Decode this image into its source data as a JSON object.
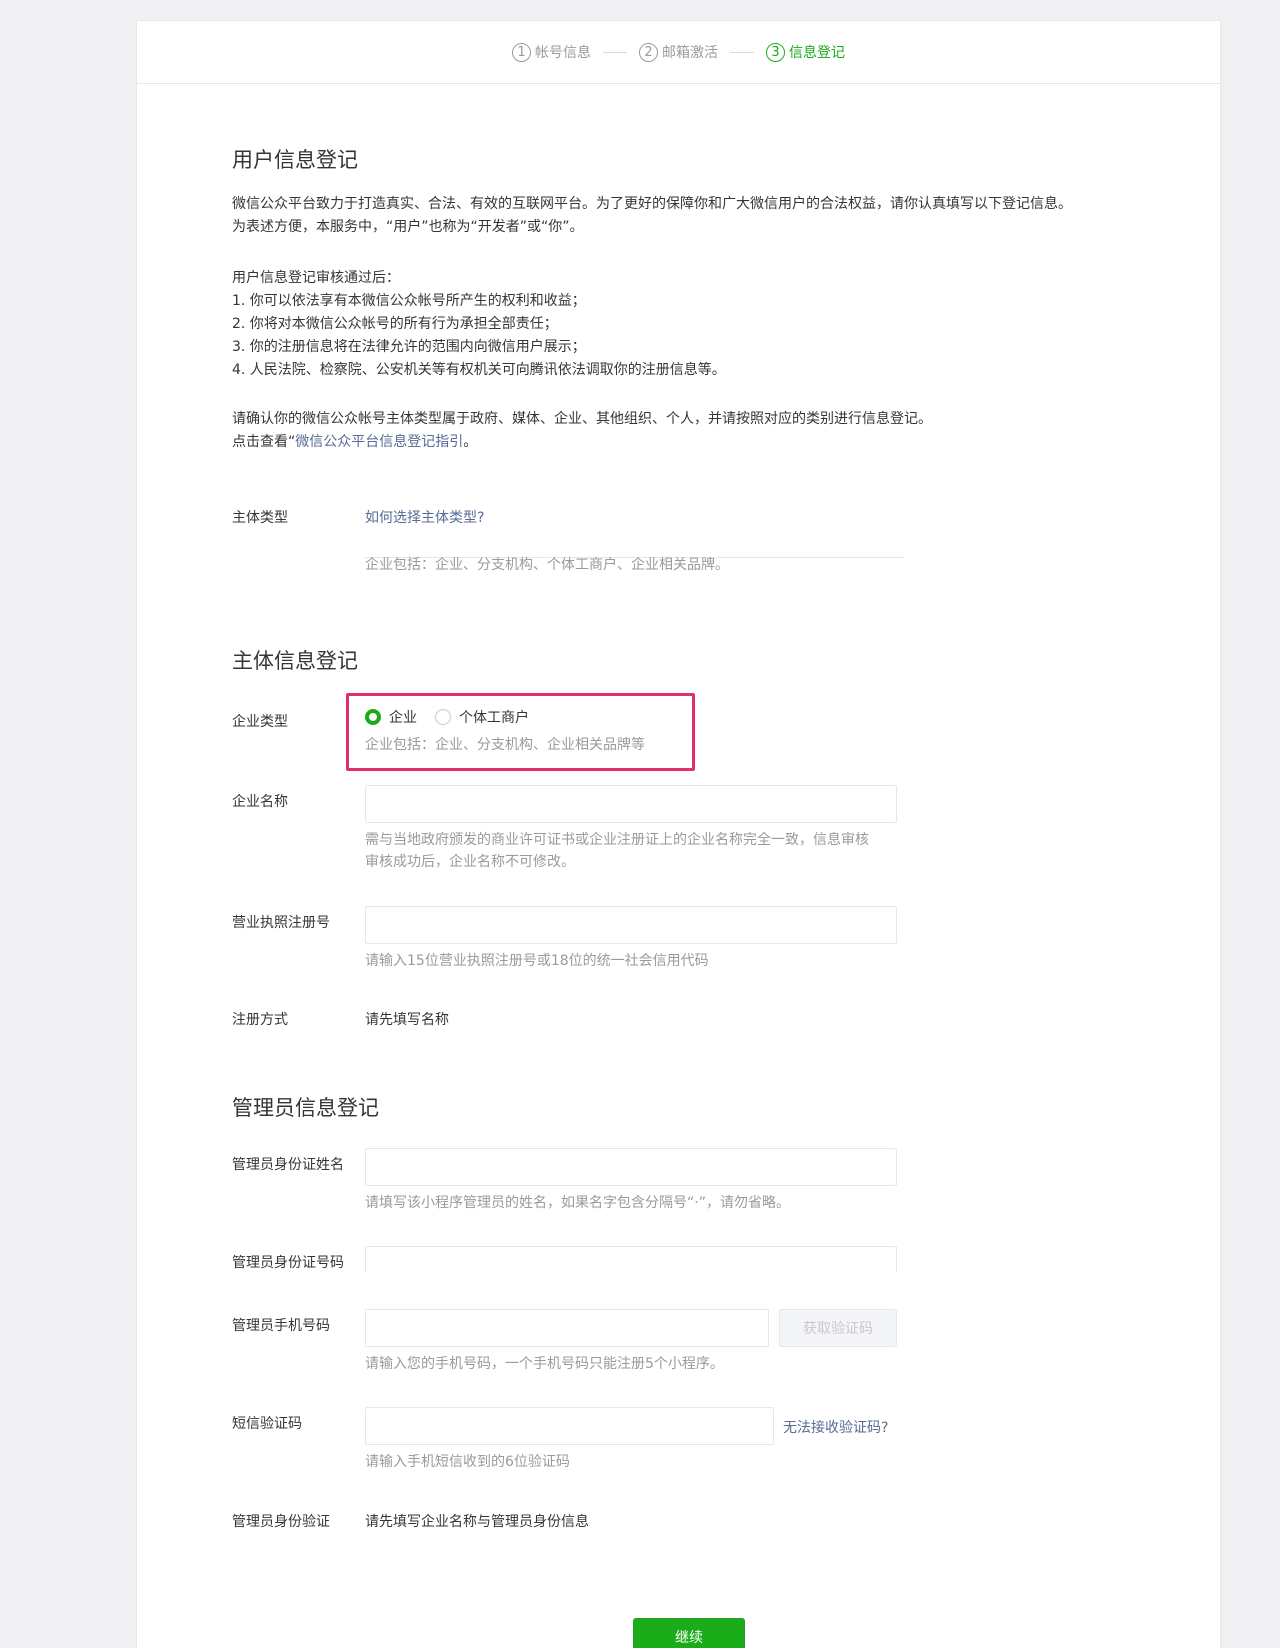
{
  "steps": [
    {
      "num": "1",
      "label": "帐号信息"
    },
    {
      "num": "2",
      "label": "邮箱激活"
    },
    {
      "num": "3",
      "label": "信息登记"
    }
  ],
  "user_section": {
    "title": "用户信息登记",
    "intro_line1": "微信公众平台致力于打造真实、合法、有效的互联网平台。为了更好的保障你和广大微信用户的合法权益，请你认真填写以下登记信息。",
    "intro_line2": "为表述方便，本服务中，“用户”也称为“开发者”或“你”。",
    "after_title": "用户信息登记审核通过后：",
    "item1": "1. 你可以依法享有本微信公众帐号所产生的权利和收益；",
    "item2": "2. 你将对本微信公众帐号的所有行为承担全部责任；",
    "item3": "3. 你的注册信息将在法律允许的范围内向微信用户展示；",
    "item4": "4. 人民法院、检察院、公安机关等有权机关可向腾讯依法调取你的注册信息等。",
    "confirm_line": "请确认你的微信公众帐号主体类型属于政府、媒体、企业、其他组织、个人，并请按照对应的类别进行信息登记。",
    "guide_prefix": "点击查看“",
    "guide_link": "微信公众平台信息登记指引",
    "guide_suffix": "。"
  },
  "subject_type": {
    "label": "主体类型",
    "link": "如何选择主体类型?",
    "tip": "企业包括：企业、分支机构、个体工商户、企业相关品牌。"
  },
  "subject_section": {
    "title": "主体信息登记",
    "company_type_label": "企业类型",
    "radio_enterprise": "企业",
    "radio_individual": "个体工商户",
    "company_type_tip": "企业包括：企业、分支机构、企业相关品牌等",
    "company_name_label": "企业名称",
    "company_name_tip1": "需与当地政府颁发的商业许可证书或企业注册证上的企业名称完全一致，信息审核",
    "company_name_tip2": "审核成功后，企业名称不可修改。",
    "license_label": "营业执照注册号",
    "license_tip": "请输入15位营业执照注册号或18位的统一社会信用代码",
    "reg_method_label": "注册方式",
    "reg_method_value": "请先填写名称"
  },
  "admin_section": {
    "title": "管理员信息登记",
    "name_label": "管理员身份证姓名",
    "name_tip": "请填写该小程序管理员的姓名，如果名字包含分隔号“·”，请勿省略。",
    "id_label": "管理员身份证号码",
    "phone_label": "管理员手机号码",
    "get_code_button": "获取验证码",
    "phone_tip": "请输入您的手机号码，一个手机号码只能注册5个小程序。",
    "sms_label": "短信验证码",
    "sms_link": "无法接收验证码?",
    "sms_tip": "请输入手机短信收到的6位验证码",
    "verify_label": "管理员身份验证",
    "verify_value": "请先填写企业名称与管理员身份信息"
  },
  "continue_button": "继续"
}
